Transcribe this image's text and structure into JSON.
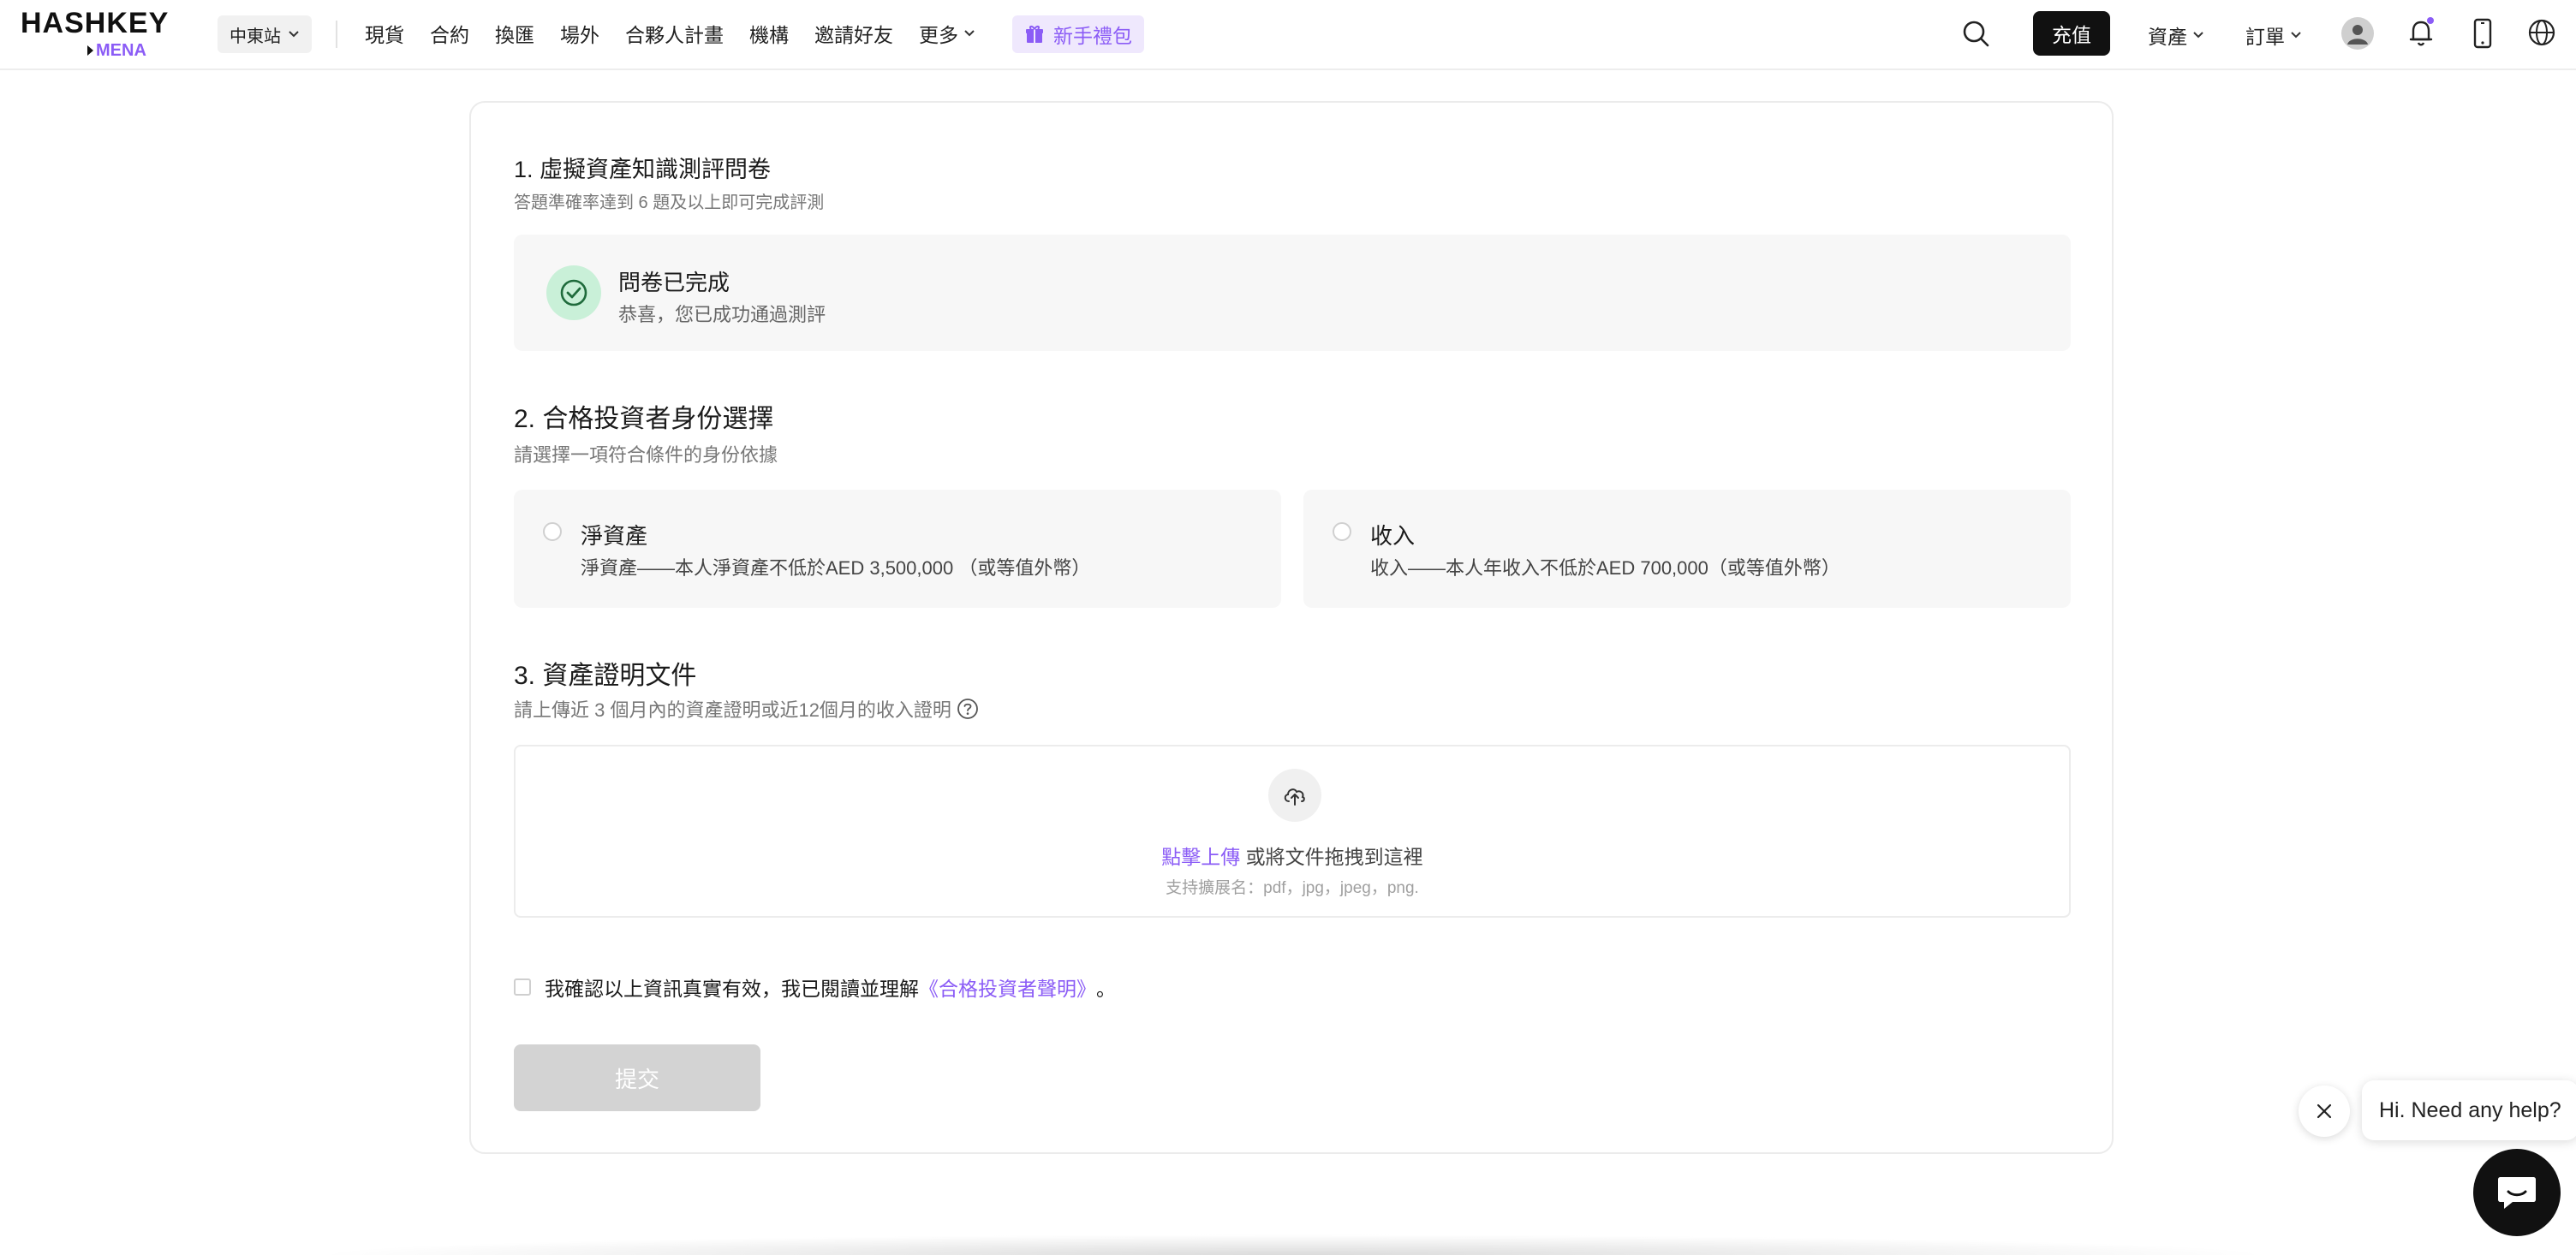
{
  "brand": {
    "name": "HASHKEY",
    "region": "MENA",
    "accent": "#8b5cf6"
  },
  "header": {
    "station": "中東站",
    "nav": [
      "現貨",
      "合約",
      "換匯",
      "場外",
      "合夥人計畫",
      "機構",
      "邀請好友"
    ],
    "more": "更多",
    "gift": "新手禮包",
    "deposit": "充值",
    "assets": "資產",
    "orders": "訂單",
    "icons": [
      "search-icon",
      "user-icon",
      "bell-icon",
      "phone-icon",
      "globe-icon"
    ]
  },
  "form": {
    "s1": {
      "title": "1. 虛擬資產知識測評問卷",
      "sub": "答題準確率達到 6 題及以上即可完成評測",
      "status_title": "問卷已完成",
      "status_sub": "恭喜，您已成功通過測評",
      "status_color": "#2f9a5a"
    },
    "s2": {
      "title": "2. 合格投資者身份選擇",
      "sub": "請選擇一項符合條件的身份依據",
      "options": [
        {
          "title": "淨資產",
          "desc": "淨資產——本人淨資產不低於AED 3,500,000 （或等值外幣）",
          "selected": false
        },
        {
          "title": "收入",
          "desc": "收入——本人年收入不低於AED 700,000（或等值外幣）",
          "selected": false
        }
      ]
    },
    "s3": {
      "title": "3. 資產證明文件",
      "sub": "請上傳近 3 個月內的資產證明或近12個月的收入證明",
      "upload_link": "點擊上傳",
      "upload_text": " 或將文件拖拽到這裡",
      "upload_hint": "支持擴展名：pdf，jpg，jpeg，png."
    },
    "agree": {
      "checked": false,
      "prefix": "我確認以上資訊真實有效，我已閱讀並理解",
      "link": "《合格投資者聲明》",
      "suffix": "。"
    },
    "submit": "提交",
    "submit_disabled": true
  },
  "help_widget": {
    "bubble": "Hi. Need any help?"
  }
}
